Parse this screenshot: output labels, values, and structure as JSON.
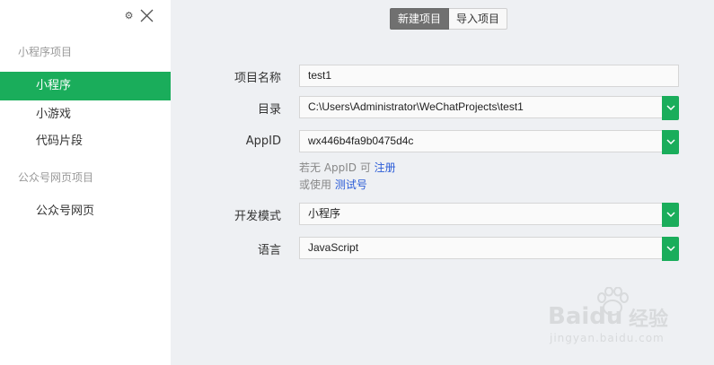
{
  "sidebar": {
    "gear_icon": "⚙",
    "sections": [
      {
        "title": "小程序项目",
        "items": [
          "小程序",
          "小游戏",
          "代码片段"
        ]
      },
      {
        "title": "公众号网页项目",
        "items": [
          "公众号网页"
        ]
      }
    ],
    "active_item": "小程序"
  },
  "tabs": [
    "新建项目",
    "导入项目"
  ],
  "form": {
    "project_name": {
      "label": "项目名称",
      "value": "test1"
    },
    "directory": {
      "label": "目录",
      "value": "C:\\Users\\Administrator\\WeChatProjects\\test1"
    },
    "appid": {
      "label": "AppID",
      "value": "wx446b4fa9b0475d4c"
    },
    "hint1": {
      "text": "若无 AppID 可 ",
      "link": "注册"
    },
    "hint2": {
      "text": "或使用 ",
      "link": "测试号"
    },
    "dev_mode": {
      "label": "开发模式",
      "value": "小程序"
    },
    "language": {
      "label": "语言",
      "value": "JavaScript"
    }
  },
  "watermark": {
    "brand": "Baidu",
    "text": "经验",
    "url": "jingyan.baidu.com"
  },
  "colors": {
    "accent": "#1aad5b",
    "link": "#2a5bd7",
    "sidebar_bg": "#ffffff",
    "main_bg": "#eef0f3"
  }
}
